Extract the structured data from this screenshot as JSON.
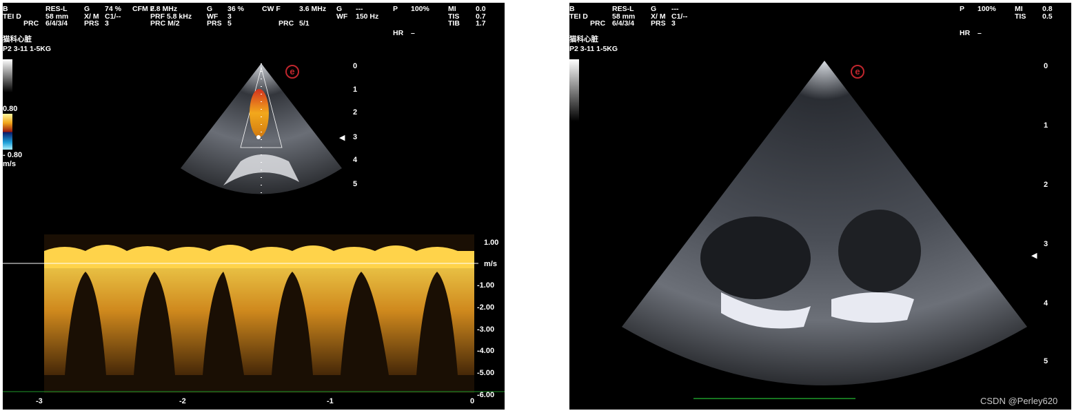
{
  "left": {
    "header": {
      "col1": [
        "B",
        "TEI  D",
        "PRC"
      ],
      "col2": [
        "RES-L",
        "58 mm",
        "6/4/3/4"
      ],
      "col3": [
        "G",
        "X/ M",
        "PRS"
      ],
      "col4": [
        "74 %",
        "C1/--",
        "3"
      ],
      "cfm": [
        "CFM F",
        "",
        ""
      ],
      "col5": [
        "2.8 MHz",
        "PRF",
        "PRC"
      ],
      "col5b": [
        "",
        "5.8 kHz",
        "M/2"
      ],
      "col6": [
        "G",
        "WF",
        "PRS"
      ],
      "col7": [
        "36 %",
        "3",
        "5"
      ],
      "cw": [
        "CW F",
        "",
        "PRC"
      ],
      "col8": [
        "3.6 MHz",
        "",
        "5/1"
      ],
      "col9": [
        "G",
        "WF",
        ""
      ],
      "col10": [
        "---",
        "150 Hz",
        ""
      ],
      "p": [
        "P",
        "",
        "",
        "HR"
      ],
      "pval": [
        "100%",
        "",
        "",
        "–"
      ],
      "mi": [
        "MI",
        "TIS",
        "TIB"
      ],
      "mival": [
        "0.0",
        "0.7",
        "1.7"
      ],
      "preset": "猫科心脏",
      "probe": "P2 3-11   1-5KG"
    },
    "scale_top": "0.80",
    "scale_bottom": "- 0.80",
    "scale_unit": "m/s",
    "depth_labels": [
      "0",
      "1",
      "2",
      "3",
      "4",
      "5"
    ],
    "velocity_labels": [
      "1.00",
      "m/s",
      "-1.00",
      "-2.00",
      "-3.00",
      "-4.00",
      "-5.00",
      "-6.00"
    ],
    "time_labels": [
      "-3",
      "-2",
      "-1",
      "0"
    ],
    "logo_glyph": "e",
    "focus_marker": "◀"
  },
  "right": {
    "header": {
      "col1": [
        "B",
        "TEI  D",
        "PRC"
      ],
      "col2": [
        "RES-L",
        "58 mm",
        "6/4/3/4"
      ],
      "col3": [
        "G",
        "X/ M",
        "PRS"
      ],
      "col4": [
        "---",
        "C1/--",
        "3"
      ],
      "p": [
        "P",
        "",
        "",
        "HR"
      ],
      "pval": [
        "100%",
        "",
        "",
        "–"
      ],
      "mi": [
        "MI",
        "TIS"
      ],
      "mival": [
        "0.8",
        "0.5"
      ],
      "preset": "猫科心脏",
      "probe": "P2 3-11   1-5KG"
    },
    "depth_labels": [
      "0",
      "1",
      "2",
      "3",
      "4",
      "5"
    ],
    "logo_glyph": "e",
    "focus_marker": "◀",
    "watermark": "CSDN @Perley620"
  },
  "colors": {
    "doppler": "#f2a81c",
    "flow_red": "#d2321e",
    "logo": "#c0262d",
    "baseline_green": "#1f9a2a"
  }
}
